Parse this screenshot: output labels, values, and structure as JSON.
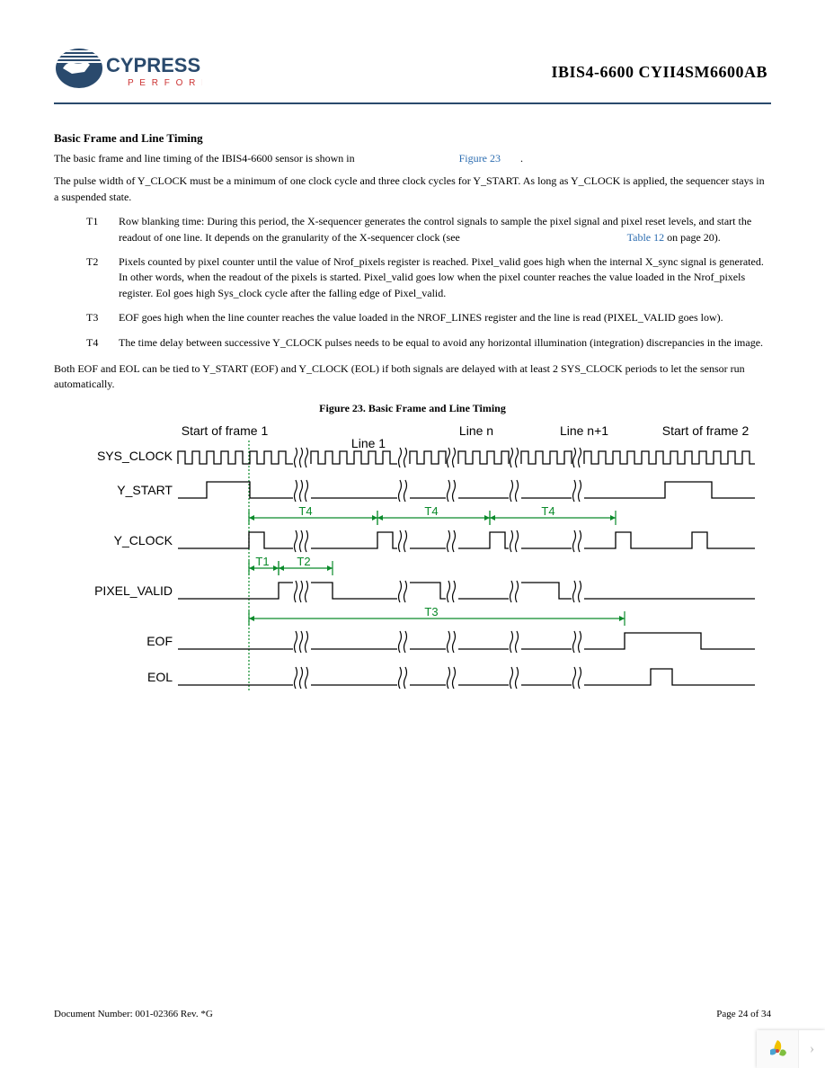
{
  "header": {
    "brand_main": "CYPRESS",
    "brand_sub": "P E R F O R M",
    "doc_title": "IBIS4-6600 CYII4SM6600AB"
  },
  "section": {
    "title": "Basic Frame and Line Timing",
    "para1": "The basic frame and line timing of the IBIS4-6600 sensor is shown in",
    "para1_link": "Figure 23",
    "para1_end": ".",
    "para2": "The pulse width of Y_CLOCK must be a minimum of one clock cycle and three clock cycles for Y_START. As long as Y_CLOCK is applied, the sequencer stays in a suspended state.",
    "t_rows": [
      {
        "label": "T1",
        "text": "Row blanking time: During this period, the X-sequencer generates the control signals to sample the pixel signal and pixel reset levels, and start the readout of one line. It depends on the granularity of the X-sequencer clock (see",
        "link": "Table 12",
        "tail": " on page 20)."
      },
      {
        "label": "T2",
        "text": "Pixels counted by pixel counter until the value of Nrof_pixels register is reached. Pixel_valid goes high when the internal X_sync signal is generated. In other words, when the readout of the pixels is started. Pixel_valid goes low when the pixel counter reaches the value loaded in the Nrof_pixels register. Eol goes high Sys_clock cycle after the falling edge of Pixel_valid."
      },
      {
        "label": "T3",
        "text": "EOF goes high when the line counter reaches the value loaded in the NROF_LINES register and the line is read (PIXEL_VALID goes low)."
      },
      {
        "label": "T4",
        "text": "The time delay between successive Y_CLOCK pulses needs to be equal to avoid any horizontal illumination (integration) discrepancies in the image."
      }
    ],
    "para3": "Both EOF and EOL can be tied to Y_START (EOF) and Y_CLOCK (EOL) if both signals are delayed with at least 2 SYS_CLOCK periods to let the sensor run automatically.",
    "figure_caption": "Figure 23.  Basic Frame and Line Timing"
  },
  "diagram": {
    "top_labels": {
      "start1": "Start of frame 1",
      "line1": "Line 1",
      "linen": "Line n",
      "linen1": "Line n+1",
      "start2": "Start of frame 2"
    },
    "signals": [
      "SYS_CLOCK",
      "Y_START",
      "Y_CLOCK",
      "PIXEL_VALID",
      "EOF",
      "EOL"
    ],
    "annotations": [
      "T4",
      "T4",
      "T4",
      "T1",
      "T2",
      "T3"
    ]
  },
  "footer": {
    "left": "Document Number: 001-02366  Rev. *G",
    "right": "Page 24 of 34"
  }
}
